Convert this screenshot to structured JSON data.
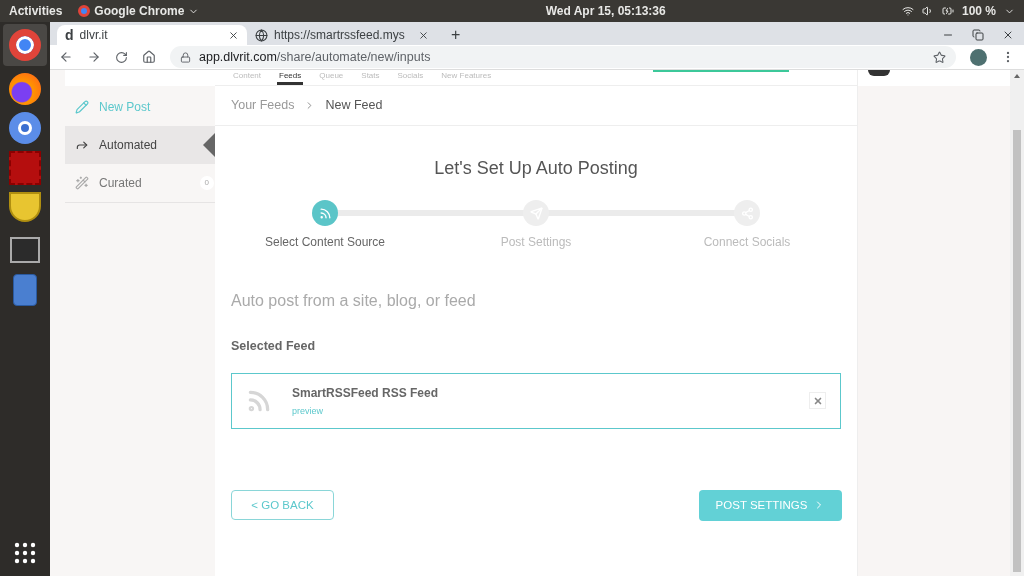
{
  "top_bar": {
    "activities": "Activities",
    "app_name": "Google Chrome",
    "clock": "Wed Apr 15, 05:13:36",
    "battery": "100 %"
  },
  "browser": {
    "tabs": [
      {
        "title": "dlvr.it",
        "favicon": "d",
        "selected": true
      },
      {
        "title": "https://smartrssfeed.mys",
        "selected": false
      }
    ],
    "new_tab": "+",
    "url_host": "app.dlvrit.com",
    "url_path": "/share/automate/new/inputs"
  },
  "page_nav": [
    {
      "label": "Content",
      "selected": false
    },
    {
      "label": "Feeds",
      "selected": true
    },
    {
      "label": "Queue",
      "selected": false
    },
    {
      "label": "Stats",
      "selected": false
    },
    {
      "label": "Socials",
      "selected": false
    },
    {
      "label": "New Features",
      "selected": false
    }
  ],
  "sidebar": {
    "items": [
      {
        "label": "New Post",
        "kind": "new",
        "selected": false
      },
      {
        "label": "Automated",
        "kind": "automated",
        "selected": true
      },
      {
        "label": "Curated",
        "kind": "curated",
        "selected": false,
        "count": "0"
      }
    ]
  },
  "breadcrumb": [
    "Your Feeds",
    "New Feed"
  ],
  "heading": "Let's Set Up Auto Posting",
  "steps": [
    {
      "label": "Select Content Source",
      "kind": "rss",
      "selected": true
    },
    {
      "label": "Post Settings",
      "kind": "send",
      "selected": false
    },
    {
      "label": "Connect Socials",
      "kind": "share",
      "selected": false
    }
  ],
  "subtitle": "Auto post from a site, blog, or feed",
  "selected_feed": {
    "title": "Selected Feed",
    "name": "SmartRSSFeed RSS Feed",
    "link": "preview"
  },
  "buttons": {
    "back": "< GO BACK",
    "next": "POST SETTINGS"
  }
}
